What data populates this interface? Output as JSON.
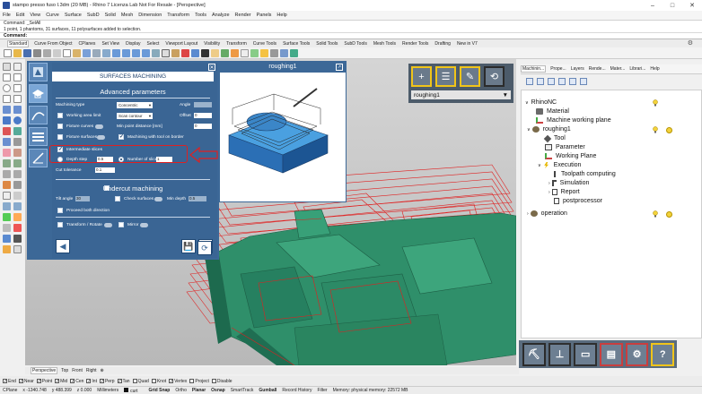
{
  "window": {
    "title": "stampo presso fuso I.3dm (20 MB) - Rhino 7 Licenza Lab Not For Resale - [Perspective]",
    "controls": [
      "–",
      "□",
      "✕"
    ]
  },
  "menu": [
    "File",
    "Edit",
    "View",
    "Curve",
    "Surface",
    "SubD",
    "Solid",
    "Mesh",
    "Dimension",
    "Transform",
    "Tools",
    "Analyze",
    "Render",
    "Panels",
    "Help"
  ],
  "command_history": [
    "Command: _SelAll",
    "1 point, 1 phantoms, 31 surfaces, 11 polysurfaces added to selection."
  ],
  "command_prompt": "Command:",
  "toolbar_tabs": [
    "Standard",
    "Curve From Object",
    "CPlanes",
    "Set View",
    "Display",
    "Select",
    "Viewport Layout",
    "Visibility",
    "Transform",
    "Curve Tools",
    "Surface Tools",
    "Solid Tools",
    "SubD Tools",
    "Mesh Tools",
    "Render Tools",
    "Drafting",
    "New in V7"
  ],
  "surfaces_panel": {
    "close_icon": "✕",
    "title": "SURFACES MACHINING",
    "section_advanced": "Advanced parameters",
    "machining_type_label": "Machining type",
    "machining_type_value": "Concentric",
    "angle_label": "Angle",
    "working_area_label": "Working area limit",
    "working_area_value": "Scan contour",
    "offset_label": "Offset",
    "offset_value": "0",
    "fixture_curves_label": "Fixture curves",
    "min_point_distance_label": "Min point distance [mm]",
    "min_point_distance_value": "0",
    "fixture_surfaces_label": "Fixture surfaces",
    "machining_tool_border_label": "Machining with tool on border",
    "intermediate_slices_label": "Intermediate slices",
    "depth_step_label": "Depth step",
    "depth_step_value": "0.5",
    "number_of_slices_label": "Number of slices",
    "number_of_slices_value": "1",
    "cut_tolerance_label": "Cut tolerance",
    "cut_tolerance_value": "0.1",
    "section_undercut": "Undercut machining",
    "tilt_angle_label": "Tilt angle",
    "tilt_angle_value": "30",
    "check_surfaces_label": "Check surfaces",
    "min_depth_label": "Min depth",
    "min_depth_value": "0.5",
    "proceed_label": "Proceed both direction",
    "transform_label": "Transform / Rotate",
    "mirror_label": "Mirror",
    "nav_back": "◀",
    "nav_save": "💾",
    "nav_next": "▶",
    "nav_refresh": "⟳"
  },
  "preview": {
    "title": "roughing1",
    "expand_icon": "↗"
  },
  "ops": {
    "dropdown_value": "roughing1"
  },
  "panel_tabs": [
    "Machinin...",
    "Prope...",
    "Layers",
    "Rende...",
    "Mater...",
    "Librari...",
    "Help"
  ],
  "tree": {
    "root": "RhinoNC",
    "material": "Material",
    "machine_plane": "Machine working plane",
    "roughing": "roughing1",
    "tool": "Tool",
    "parameter": "Parameter",
    "working_plane": "Working Plane",
    "execution": "Execution",
    "toolpath": "Toolpath computing",
    "simulation": "Simulation",
    "report": "Report",
    "postprocessor": "postprocessor",
    "operation": "operation"
  },
  "viewport_tabs": [
    "Perspective",
    "Top",
    "Front",
    "Right",
    "⊕"
  ],
  "osnaps": [
    {
      "label": "End",
      "on": true
    },
    {
      "label": "Near",
      "on": true
    },
    {
      "label": "Point",
      "on": true
    },
    {
      "label": "Mid",
      "on": true
    },
    {
      "label": "Cen",
      "on": true
    },
    {
      "label": "Int",
      "on": true
    },
    {
      "label": "Perp",
      "on": true
    },
    {
      "label": "Tan",
      "on": true
    },
    {
      "label": "Quad",
      "on": false
    },
    {
      "label": "Knot",
      "on": false
    },
    {
      "label": "Vertex",
      "on": true
    },
    {
      "label": "Project",
      "on": false
    },
    {
      "label": "Disable",
      "on": false
    }
  ],
  "status": {
    "cplane": "CPlane",
    "x": "x -1340.748",
    "y": "y 488.399",
    "z": "z 0.000",
    "units": "Millimeters",
    "layer": "curt",
    "grid_snap": "Grid Snap",
    "ortho": "Ortho",
    "planar": "Planar",
    "osnap": "Osnap",
    "smarttrack": "SmartTrack",
    "gumball": "Gumball",
    "record_history": "Record History",
    "filter": "Filter",
    "memory": "Memory: physical memory: 22572 MB"
  },
  "colors": {
    "panel_blue": "#3c6897",
    "mesh_green": "#2f8f6a",
    "toolpath_red": "#e02020",
    "highlight_red": "#e02020",
    "ops_yellow": "#f0c419"
  }
}
